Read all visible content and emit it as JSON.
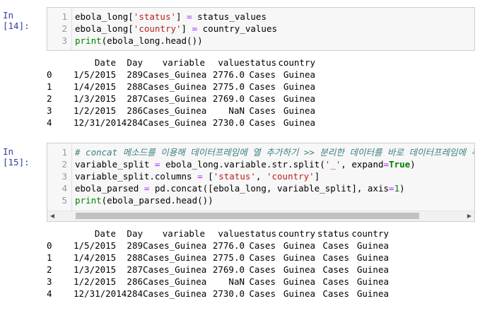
{
  "cells": [
    {
      "prompt": "In [14]:",
      "code_lines": [
        {
          "n": "1",
          "text": ""
        },
        {
          "n": "2",
          "text": ""
        },
        {
          "n": "3",
          "text": ""
        }
      ],
      "code_segments": [
        [
          [
            "ebola_long[",
            ""
          ],
          [
            "'status'",
            "str"
          ],
          [
            "] ",
            ""
          ],
          [
            "=",
            "op"
          ],
          [
            " status_values",
            ""
          ]
        ],
        [
          [
            "ebola_long[",
            ""
          ],
          [
            "'country'",
            "str"
          ],
          [
            "] ",
            ""
          ],
          [
            "=",
            "op"
          ],
          [
            " country_values",
            ""
          ]
        ],
        [
          [
            "print",
            "kw"
          ],
          [
            "(ebola_long.head())",
            ""
          ]
        ]
      ],
      "table": {
        "columns": [
          "",
          "Date",
          "Day",
          "variable",
          "value",
          "status",
          "country"
        ],
        "rows": [
          [
            "0",
            "1/5/2015",
            "289",
            "Cases_Guinea",
            "2776.0",
            "Cases",
            "Guinea"
          ],
          [
            "1",
            "1/4/2015",
            "288",
            "Cases_Guinea",
            "2775.0",
            "Cases",
            "Guinea"
          ],
          [
            "2",
            "1/3/2015",
            "287",
            "Cases_Guinea",
            "2769.0",
            "Cases",
            "Guinea"
          ],
          [
            "3",
            "1/2/2015",
            "286",
            "Cases_Guinea",
            "NaN",
            "Cases",
            "Guinea"
          ],
          [
            "4",
            "12/31/2014",
            "284",
            "Cases_Guinea",
            "2730.0",
            "Cases",
            "Guinea"
          ]
        ]
      }
    },
    {
      "prompt": "In [15]:",
      "code_lines": [
        {
          "n": "1"
        },
        {
          "n": "2"
        },
        {
          "n": "3"
        },
        {
          "n": "4"
        },
        {
          "n": "5"
        }
      ],
      "code_segments": [
        [
          [
            "# concat 메소드를 이용해 데이터프레임에 열 추가하기 >> 분리한 데이터를 바로 데이터프레임에 추가",
            "cmt"
          ]
        ],
        [
          [
            "variable_split ",
            ""
          ],
          [
            "=",
            "op"
          ],
          [
            " ebola_long.variable.str.split(",
            ""
          ],
          [
            "'_'",
            "str"
          ],
          [
            ", expand",
            ""
          ],
          [
            "=",
            "op"
          ],
          [
            "True",
            "kwb"
          ],
          [
            ")",
            ""
          ]
        ],
        [
          [
            "variable_split.columns ",
            ""
          ],
          [
            "=",
            "op"
          ],
          [
            " [",
            ""
          ],
          [
            "'status'",
            "str"
          ],
          [
            ", ",
            ""
          ],
          [
            "'country'",
            "str"
          ],
          [
            "]",
            ""
          ]
        ],
        [
          [
            "ebola_parsed ",
            ""
          ],
          [
            "=",
            "op"
          ],
          [
            " pd.concat([ebola_long, variable_split], axis",
            ""
          ],
          [
            "=",
            "op"
          ],
          [
            "1",
            "num"
          ],
          [
            ")",
            ""
          ]
        ],
        [
          [
            "print",
            "kw"
          ],
          [
            "(ebola_parsed.head())",
            ""
          ]
        ]
      ],
      "table": {
        "columns": [
          "",
          "Date",
          "Day",
          "variable",
          "value",
          "status",
          "country",
          "status",
          "country"
        ],
        "rows": [
          [
            "0",
            "1/5/2015",
            "289",
            "Cases_Guinea",
            "2776.0",
            "Cases",
            "Guinea",
            "Cases",
            "Guinea"
          ],
          [
            "1",
            "1/4/2015",
            "288",
            "Cases_Guinea",
            "2775.0",
            "Cases",
            "Guinea",
            "Cases",
            "Guinea"
          ],
          [
            "2",
            "1/3/2015",
            "287",
            "Cases_Guinea",
            "2769.0",
            "Cases",
            "Guinea",
            "Cases",
            "Guinea"
          ],
          [
            "3",
            "1/2/2015",
            "286",
            "Cases_Guinea",
            "NaN",
            "Cases",
            "Guinea",
            "Cases",
            "Guinea"
          ],
          [
            "4",
            "12/31/2014",
            "284",
            "Cases_Guinea",
            "2730.0",
            "Cases",
            "Guinea",
            "Cases",
            "Guinea"
          ]
        ]
      }
    }
  ]
}
